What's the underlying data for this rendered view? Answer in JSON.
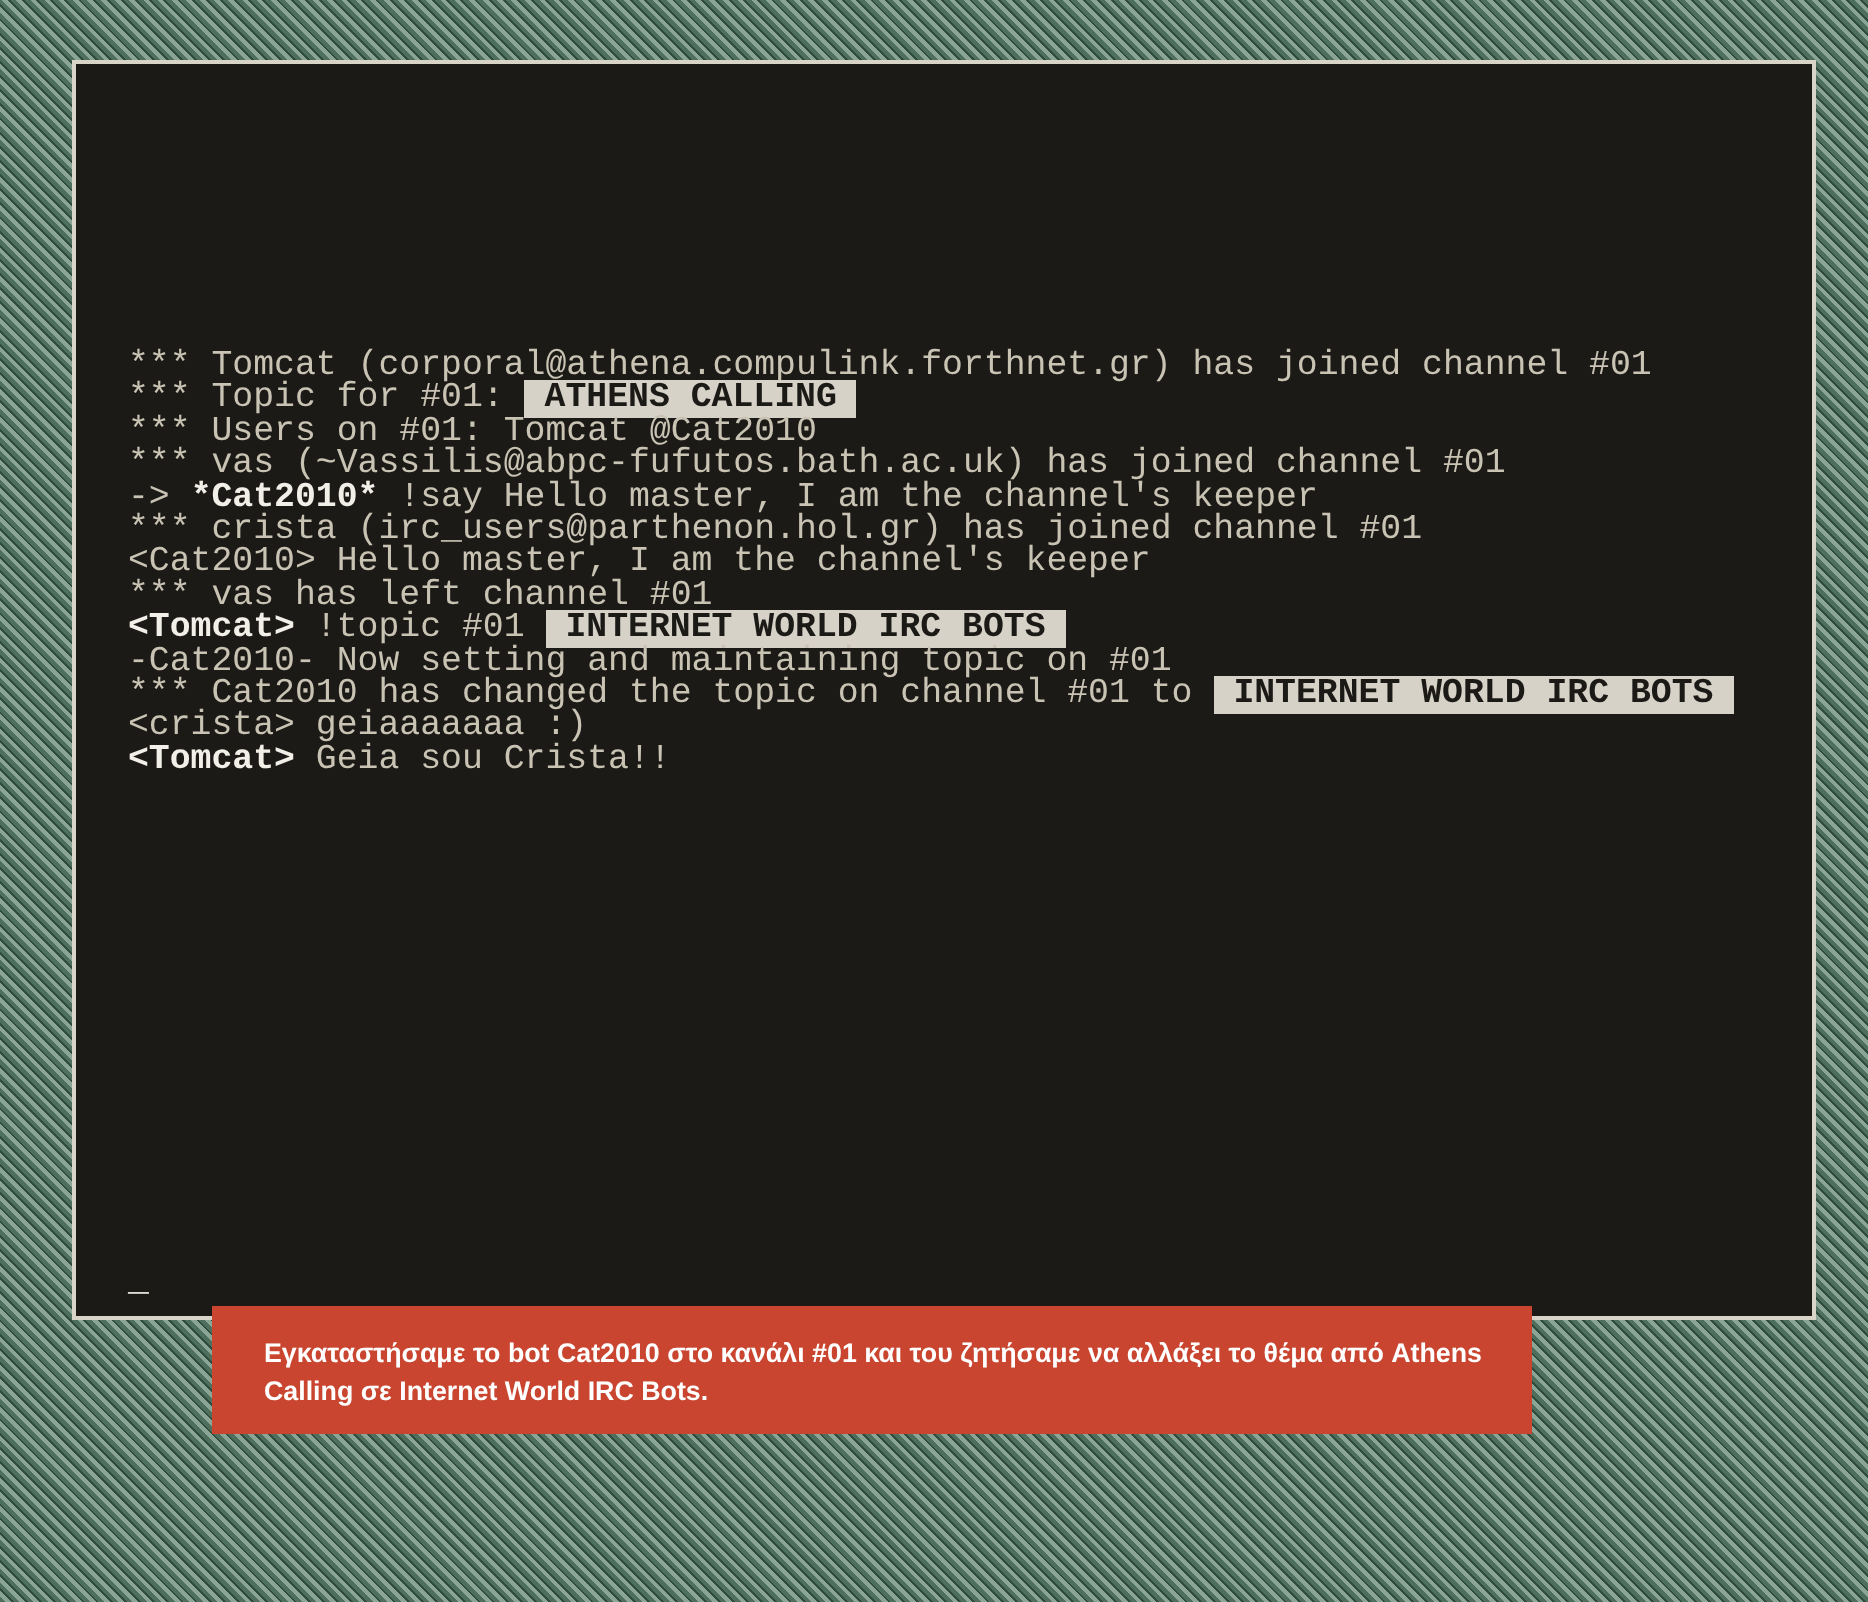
{
  "terminal": {
    "lines": [
      [
        {
          "kind": "text",
          "text": "*** Tomcat (corporal@athena.compulink.forthnet.gr) has joined channel #01"
        }
      ],
      [
        {
          "kind": "text",
          "text": "*** Topic for #01: "
        },
        {
          "kind": "highlight",
          "text": "ATHENS CALLING"
        }
      ],
      [
        {
          "kind": "text",
          "text": "*** Users on #01: Tomcat @Cat2010"
        }
      ],
      [
        {
          "kind": "text",
          "text": "*** vas (~Vassilis@abpc-fufutos.bath.ac.uk) has joined channel #01"
        }
      ],
      [
        {
          "kind": "text",
          "text": "-> "
        },
        {
          "kind": "bold",
          "text": "*Cat2010*"
        },
        {
          "kind": "text",
          "text": " !say Hello master, I am the channel's keeper"
        }
      ],
      [
        {
          "kind": "text",
          "text": "*** crista (irc_users@parthenon.hol.gr) has joined channel #01"
        }
      ],
      [
        {
          "kind": "text",
          "text": "<Cat2010> Hello master, I am the channel's keeper"
        }
      ],
      [
        {
          "kind": "text",
          "text": "*** vas has left channel #01"
        }
      ],
      [
        {
          "kind": "bold",
          "text": "<Tomcat>"
        },
        {
          "kind": "text",
          "text": " !topic #01 "
        },
        {
          "kind": "highlight",
          "text": "INTERNET WORLD IRC BOTS"
        }
      ],
      [
        {
          "kind": "text",
          "text": "-Cat2010- Now setting and maintaining topic on #01"
        }
      ],
      [
        {
          "kind": "text",
          "text": "*** Cat2010 has changed the topic on channel #01 to "
        },
        {
          "kind": "highlight",
          "text": "INTERNET WORLD IRC BOTS"
        }
      ],
      [
        {
          "kind": "text",
          "text": "<crista> geiaaaaaaa :)"
        }
      ],
      [
        {
          "kind": "bold",
          "text": "<Tomcat>"
        },
        {
          "kind": "text",
          "text": " Geia sou Crista!!"
        }
      ]
    ],
    "cursor": "_"
  },
  "caption": "Εγκαταστήσαμε το bot Cat2010 στο κανάλι #01 και του ζητήσαμε να αλλάξει το θέμα από Athens Calling σε Internet World IRC Bots."
}
